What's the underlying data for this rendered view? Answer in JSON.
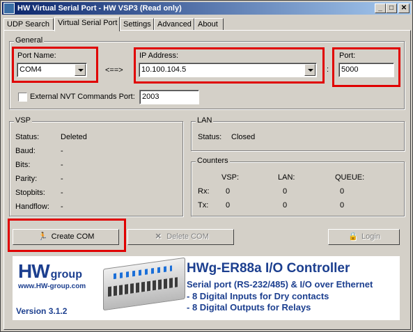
{
  "window": {
    "title": "HW Virtual Serial Port - HW VSP3 (Read only)",
    "controls": {
      "minimize": "_",
      "maximize": "□",
      "close": "✕"
    }
  },
  "tabs": [
    {
      "label": "UDP Search",
      "active": false
    },
    {
      "label": "Virtual Serial Port",
      "active": true
    },
    {
      "label": "Settings",
      "active": false
    },
    {
      "label": "Advanced",
      "active": false
    },
    {
      "label": "About",
      "active": false
    }
  ],
  "general": {
    "title": "General",
    "port_name_label": "Port Name:",
    "port_name_value": "COM4",
    "arrow": "<==>",
    "ip_label": "IP Address:",
    "ip_value": "10.100.104.5",
    "colon": ":",
    "port_label": "Port:",
    "port_value": "5000",
    "nvt_label": "External NVT Commands Port:",
    "nvt_checked": false,
    "nvt_value": "2003"
  },
  "vsp": {
    "title": "VSP",
    "rows": [
      {
        "label": "Status:",
        "value": "Deleted"
      },
      {
        "label": "Baud:",
        "value": "-"
      },
      {
        "label": "Bits:",
        "value": "-"
      },
      {
        "label": "Parity:",
        "value": "-"
      },
      {
        "label": "Stopbits:",
        "value": "-"
      },
      {
        "label": "Handflow:",
        "value": "-"
      }
    ]
  },
  "lan": {
    "title": "LAN",
    "status_label": "Status:",
    "status_value": "Closed"
  },
  "counters": {
    "title": "Counters",
    "headers": [
      "VSP:",
      "LAN:",
      "QUEUE:"
    ],
    "rows": [
      {
        "label": "Rx:",
        "values": [
          "0",
          "0",
          "0"
        ]
      },
      {
        "label": "Tx:",
        "values": [
          "0",
          "0",
          "0"
        ]
      }
    ]
  },
  "buttons": {
    "create": "Create COM",
    "delete": "Delete COM",
    "login": "Login"
  },
  "banner": {
    "logo_main": "HW",
    "logo_sub": "group",
    "website": "www.HW-group.com",
    "version": "Version  3.1.2",
    "product_title": "HWg-ER88a  I/O Controller",
    "lines": [
      "Serial port (RS-232/485) & I/O over Ethernet",
      " - 8 Digital Inputs for Dry contacts",
      " - 8 Digital Outputs for Relays"
    ]
  },
  "colors": {
    "highlight": "#e00000",
    "brand": "#1c3f8f",
    "title_bar": "#0a246a"
  }
}
